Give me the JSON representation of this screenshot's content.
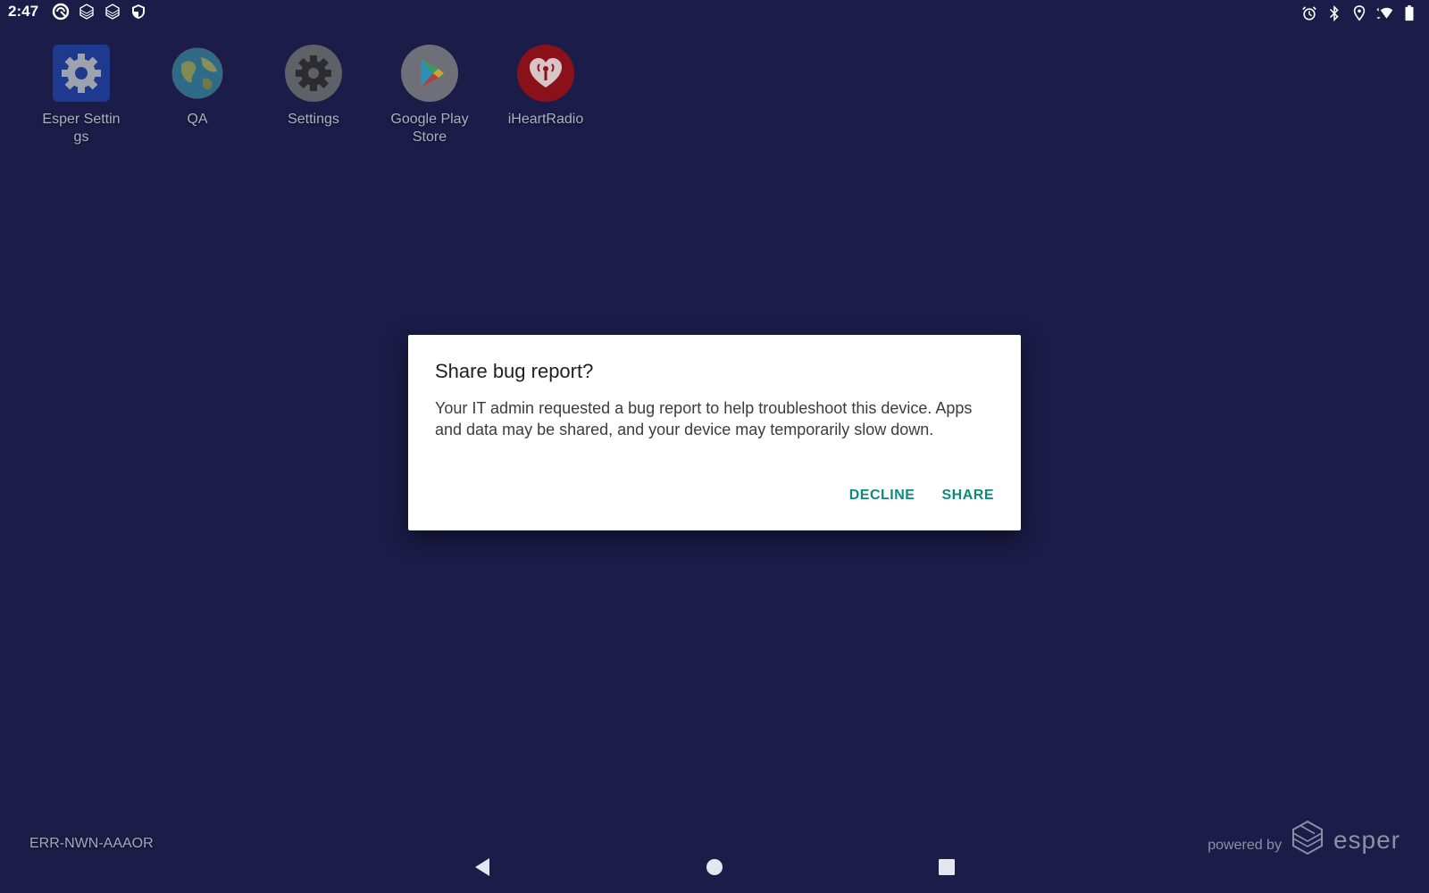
{
  "status_bar": {
    "time": "2:47",
    "left_icons": [
      "esper-circle-icon",
      "cube-icon",
      "cube-icon",
      "shield-icon"
    ],
    "right_icons": [
      "alarm-icon",
      "bluetooth-icon",
      "location-icon",
      "wifi-icon",
      "battery-icon"
    ]
  },
  "apps": [
    {
      "label": "Esper Settings",
      "icon": "gear-icon"
    },
    {
      "label": "QA",
      "icon": "globe-icon"
    },
    {
      "label": "Settings",
      "icon": "gear-icon"
    },
    {
      "label": "Google Play Store",
      "icon": "play-store-icon"
    },
    {
      "label": "iHeartRadio",
      "icon": "iheartradio-icon"
    }
  ],
  "dialog": {
    "title": "Share bug report?",
    "body": "Your IT admin requested a bug report to help troubleshoot this device. Apps and data may be shared, and your device may temporarily slow down.",
    "decline_label": "DECLINE",
    "share_label": "SHARE"
  },
  "footer": {
    "device_id": "ERR-NWN-AAAOR",
    "powered_by": "powered by",
    "brand": "esper"
  },
  "nav_bar": {
    "back": "back-icon",
    "home": "home-icon",
    "recents": "recents-icon"
  },
  "colors": {
    "background": "#1b1c47",
    "accent": "#0d8a7c",
    "dialog_bg": "#ffffff"
  }
}
